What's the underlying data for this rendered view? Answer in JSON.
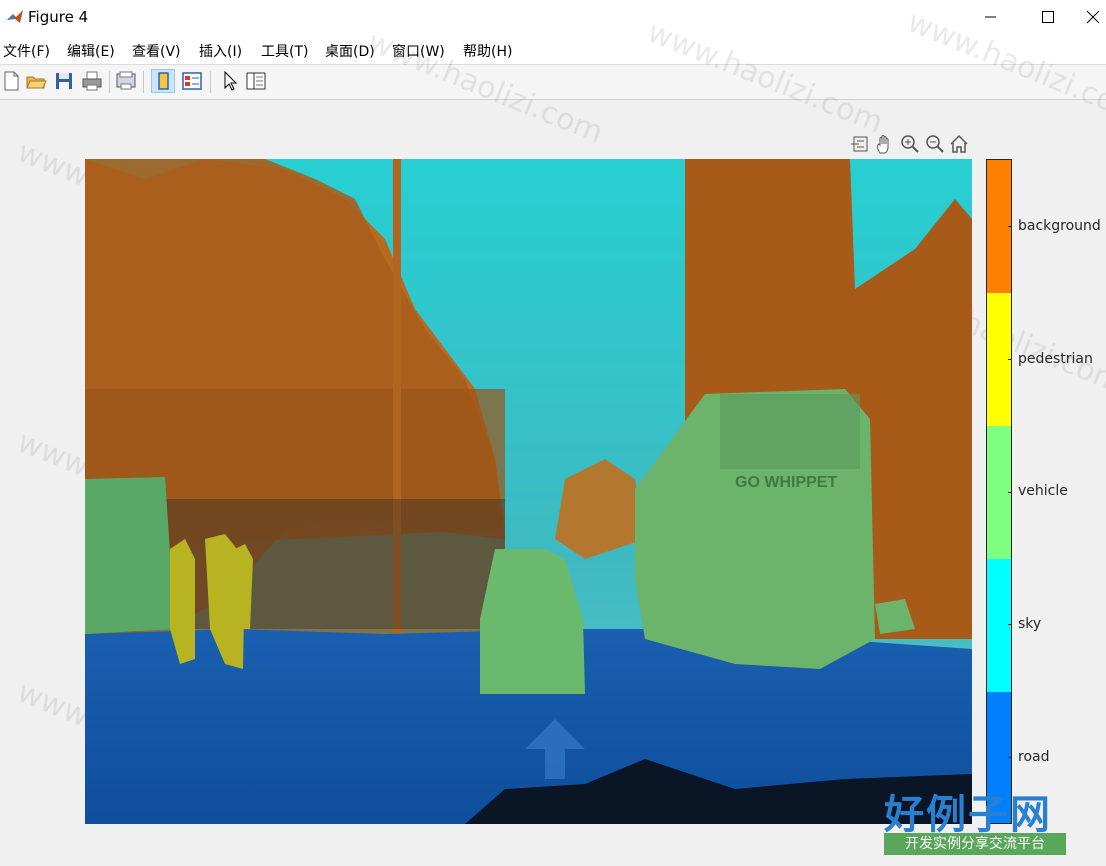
{
  "window": {
    "title": "Figure 4"
  },
  "menu": [
    "文件(F)",
    "编辑(E)",
    "查看(V)",
    "插入(I)",
    "工具(T)",
    "桌面(D)",
    "窗口(W)",
    "帮助(H)"
  ],
  "toolbar": {
    "buttons": [
      "new-figure-icon",
      "open-file-icon",
      "save-icon",
      "print-icon",
      "print-preview-icon",
      "hide-plot-tools-icon",
      "show-plot-tools-icon",
      "edit-plot-icon",
      "open-property-inspector-icon"
    ]
  },
  "axes_toolbar": [
    "brush-icon",
    "pan-hand-icon",
    "zoom-in-icon",
    "zoom-out-icon",
    "restore-view-icon"
  ],
  "colorbar": {
    "labels": [
      "background",
      "pedestrian",
      "vehicle",
      "sky",
      "road"
    ],
    "colors": [
      "#ff7f00",
      "#ffff00",
      "#7fff7f",
      "#00ffff",
      "#007fff"
    ]
  },
  "image": {
    "description_type": "semantic segmentation overlay",
    "bus_text": "GO WHIPPET"
  },
  "watermark": {
    "text": "www.haolizi.com",
    "logo": "好例子网",
    "logo_sub": "开发实例分享交流平台"
  }
}
